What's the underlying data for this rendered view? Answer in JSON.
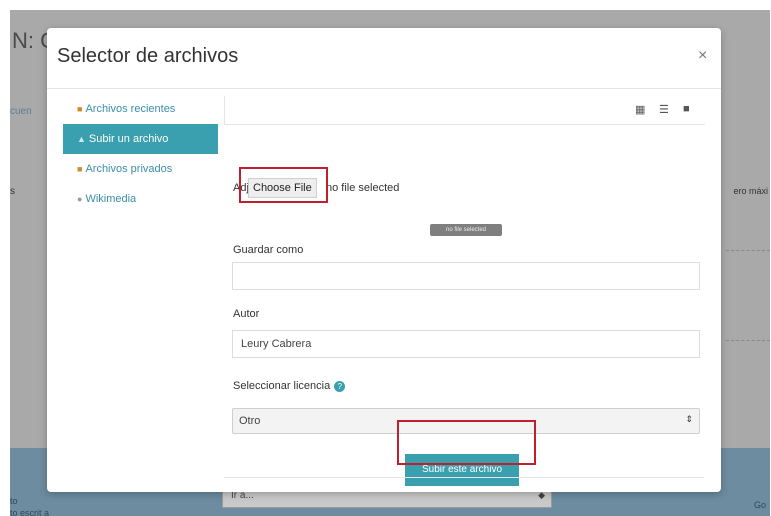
{
  "background": {
    "title": "N: C",
    "left_link": "cuen",
    "left_label": "s",
    "right_label": "ero máxi",
    "footer_lines": [
      "to",
      "to escrit a"
    ],
    "select_value": "Ir a...",
    "footer_right": "Go"
  },
  "modal": {
    "title": "Selector de archivos",
    "close_icon": "×"
  },
  "sidebar": {
    "items": [
      {
        "label": "Archivos recientes",
        "icon": "recent-files-icon",
        "active": false
      },
      {
        "label": "Subir un archivo",
        "icon": "upload-icon",
        "active": true
      },
      {
        "label": "Archivos privados",
        "icon": "private-files-icon",
        "active": false
      },
      {
        "label": "Wikimedia",
        "icon": "wikimedia-icon",
        "active": false
      }
    ]
  },
  "toolbar": {
    "icons": [
      "grid-view-icon",
      "list-view-icon",
      "folder-view-icon"
    ]
  },
  "form": {
    "attachment_label": "Adjunto",
    "choose_file_label": "Choose File",
    "no_file_text": "no file selected",
    "tooltip_text": "no file selected",
    "save_as_label": "Guardar como",
    "save_as_value": "",
    "author_label": "Autor",
    "author_value": "Leury Cabrera",
    "license_label": "Seleccionar licencia",
    "license_value": "Otro",
    "submit_label": "Subir este archivo"
  },
  "colors": {
    "accent": "#3a9fae",
    "highlight": "#c0202e",
    "overlay": "#a9a9a9"
  }
}
